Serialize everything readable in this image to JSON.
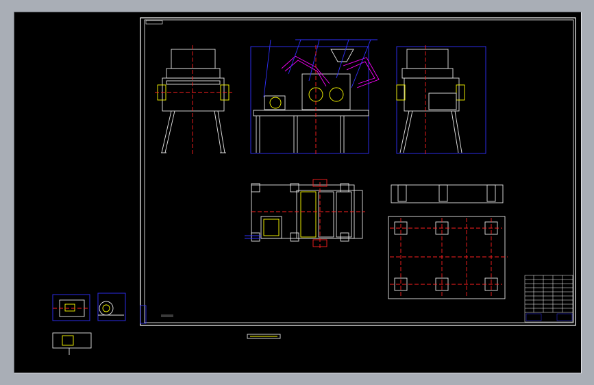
{
  "drawing": {
    "sheet_label": "",
    "ucs_label": "",
    "colors": {
      "background": "#000000",
      "frame": "#ffffff",
      "geometry": "#e8e8e8",
      "centerline": "#ff2020",
      "construction": "#3030ff",
      "highlight": "#ff00ff",
      "dimension": "#ffff00",
      "cyan": "#00ffff",
      "title_block": "#ffffff"
    }
  }
}
